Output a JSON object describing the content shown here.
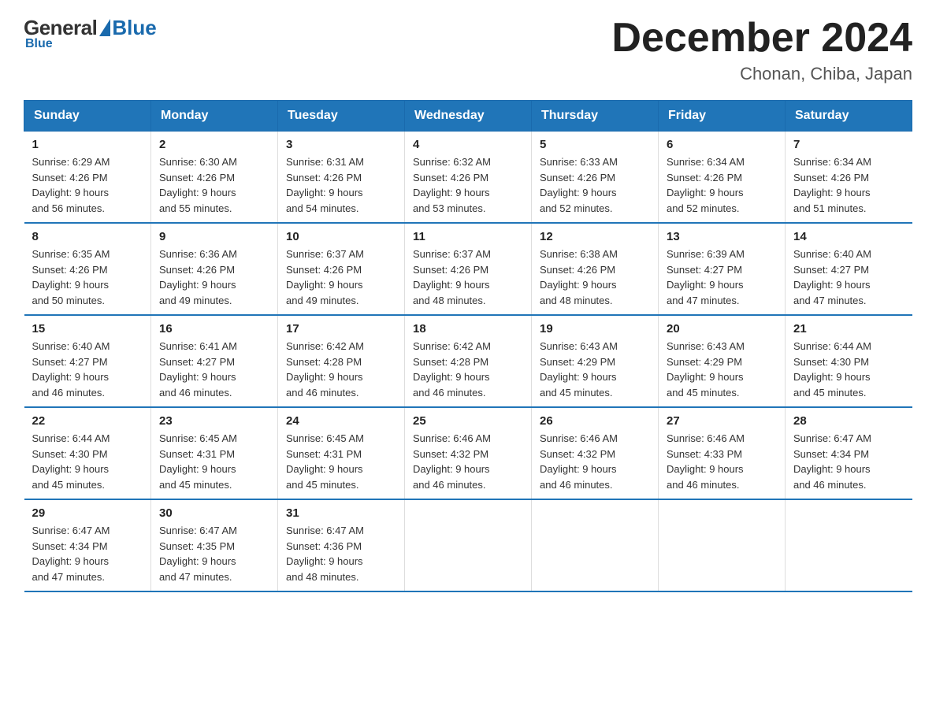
{
  "logo": {
    "general": "General",
    "blue": "Blue",
    "subtitle": "Blue"
  },
  "title": {
    "month": "December 2024",
    "location": "Chonan, Chiba, Japan"
  },
  "weekdays": [
    "Sunday",
    "Monday",
    "Tuesday",
    "Wednesday",
    "Thursday",
    "Friday",
    "Saturday"
  ],
  "weeks": [
    [
      {
        "day": "1",
        "sunrise": "6:29 AM",
        "sunset": "4:26 PM",
        "daylight": "9 hours and 56 minutes."
      },
      {
        "day": "2",
        "sunrise": "6:30 AM",
        "sunset": "4:26 PM",
        "daylight": "9 hours and 55 minutes."
      },
      {
        "day": "3",
        "sunrise": "6:31 AM",
        "sunset": "4:26 PM",
        "daylight": "9 hours and 54 minutes."
      },
      {
        "day": "4",
        "sunrise": "6:32 AM",
        "sunset": "4:26 PM",
        "daylight": "9 hours and 53 minutes."
      },
      {
        "day": "5",
        "sunrise": "6:33 AM",
        "sunset": "4:26 PM",
        "daylight": "9 hours and 52 minutes."
      },
      {
        "day": "6",
        "sunrise": "6:34 AM",
        "sunset": "4:26 PM",
        "daylight": "9 hours and 52 minutes."
      },
      {
        "day": "7",
        "sunrise": "6:34 AM",
        "sunset": "4:26 PM",
        "daylight": "9 hours and 51 minutes."
      }
    ],
    [
      {
        "day": "8",
        "sunrise": "6:35 AM",
        "sunset": "4:26 PM",
        "daylight": "9 hours and 50 minutes."
      },
      {
        "day": "9",
        "sunrise": "6:36 AM",
        "sunset": "4:26 PM",
        "daylight": "9 hours and 49 minutes."
      },
      {
        "day": "10",
        "sunrise": "6:37 AM",
        "sunset": "4:26 PM",
        "daylight": "9 hours and 49 minutes."
      },
      {
        "day": "11",
        "sunrise": "6:37 AM",
        "sunset": "4:26 PM",
        "daylight": "9 hours and 48 minutes."
      },
      {
        "day": "12",
        "sunrise": "6:38 AM",
        "sunset": "4:26 PM",
        "daylight": "9 hours and 48 minutes."
      },
      {
        "day": "13",
        "sunrise": "6:39 AM",
        "sunset": "4:27 PM",
        "daylight": "9 hours and 47 minutes."
      },
      {
        "day": "14",
        "sunrise": "6:40 AM",
        "sunset": "4:27 PM",
        "daylight": "9 hours and 47 minutes."
      }
    ],
    [
      {
        "day": "15",
        "sunrise": "6:40 AM",
        "sunset": "4:27 PM",
        "daylight": "9 hours and 46 minutes."
      },
      {
        "day": "16",
        "sunrise": "6:41 AM",
        "sunset": "4:27 PM",
        "daylight": "9 hours and 46 minutes."
      },
      {
        "day": "17",
        "sunrise": "6:42 AM",
        "sunset": "4:28 PM",
        "daylight": "9 hours and 46 minutes."
      },
      {
        "day": "18",
        "sunrise": "6:42 AM",
        "sunset": "4:28 PM",
        "daylight": "9 hours and 46 minutes."
      },
      {
        "day": "19",
        "sunrise": "6:43 AM",
        "sunset": "4:29 PM",
        "daylight": "9 hours and 45 minutes."
      },
      {
        "day": "20",
        "sunrise": "6:43 AM",
        "sunset": "4:29 PM",
        "daylight": "9 hours and 45 minutes."
      },
      {
        "day": "21",
        "sunrise": "6:44 AM",
        "sunset": "4:30 PM",
        "daylight": "9 hours and 45 minutes."
      }
    ],
    [
      {
        "day": "22",
        "sunrise": "6:44 AM",
        "sunset": "4:30 PM",
        "daylight": "9 hours and 45 minutes."
      },
      {
        "day": "23",
        "sunrise": "6:45 AM",
        "sunset": "4:31 PM",
        "daylight": "9 hours and 45 minutes."
      },
      {
        "day": "24",
        "sunrise": "6:45 AM",
        "sunset": "4:31 PM",
        "daylight": "9 hours and 45 minutes."
      },
      {
        "day": "25",
        "sunrise": "6:46 AM",
        "sunset": "4:32 PM",
        "daylight": "9 hours and 46 minutes."
      },
      {
        "day": "26",
        "sunrise": "6:46 AM",
        "sunset": "4:32 PM",
        "daylight": "9 hours and 46 minutes."
      },
      {
        "day": "27",
        "sunrise": "6:46 AM",
        "sunset": "4:33 PM",
        "daylight": "9 hours and 46 minutes."
      },
      {
        "day": "28",
        "sunrise": "6:47 AM",
        "sunset": "4:34 PM",
        "daylight": "9 hours and 46 minutes."
      }
    ],
    [
      {
        "day": "29",
        "sunrise": "6:47 AM",
        "sunset": "4:34 PM",
        "daylight": "9 hours and 47 minutes."
      },
      {
        "day": "30",
        "sunrise": "6:47 AM",
        "sunset": "4:35 PM",
        "daylight": "9 hours and 47 minutes."
      },
      {
        "day": "31",
        "sunrise": "6:47 AM",
        "sunset": "4:36 PM",
        "daylight": "9 hours and 48 minutes."
      },
      null,
      null,
      null,
      null
    ]
  ],
  "labels": {
    "sunrise": "Sunrise: ",
    "sunset": "Sunset: ",
    "daylight": "Daylight: "
  }
}
